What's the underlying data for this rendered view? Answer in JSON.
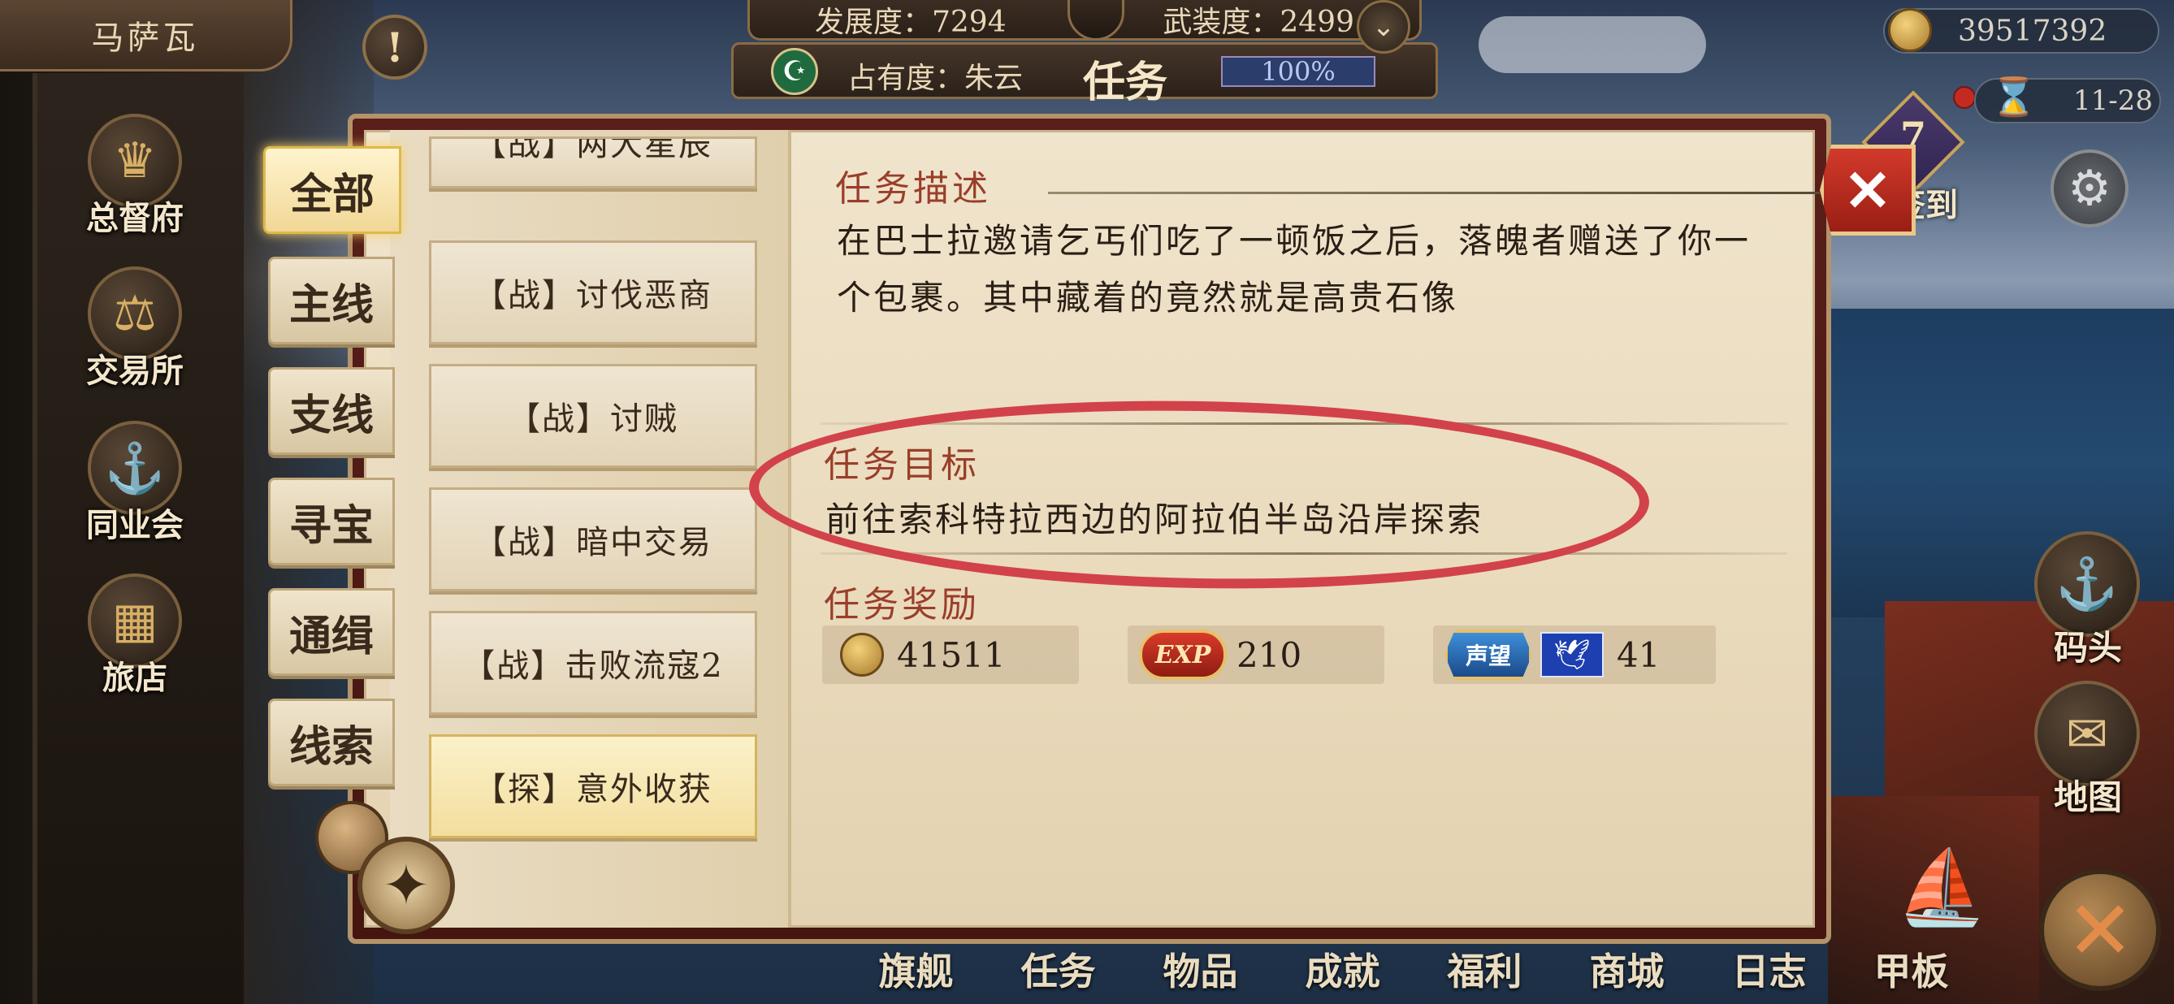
{
  "top_left": {
    "city_name": "马萨瓦",
    "alert_symbol": "!"
  },
  "stats": {
    "development": "发展度：7294",
    "armament": "武装度：2499",
    "occupancy_label": "占有度：朱云",
    "occupancy_value": "100%",
    "crescent_icon": "crescent-star-icon",
    "title": "任务"
  },
  "currency": {
    "gold": "39517392",
    "time": "11-28"
  },
  "signin": {
    "number": "7",
    "label": "签到"
  },
  "side_menu": [
    {
      "label": "总督府",
      "icon": "crown-icon",
      "glyph": "♛"
    },
    {
      "label": "交易所",
      "icon": "scales-icon",
      "glyph": "⚖"
    },
    {
      "label": "同业会",
      "icon": "anchor-shield-icon",
      "glyph": "⚓"
    },
    {
      "label": "旅店",
      "icon": "inn-icon",
      "glyph": "▦"
    }
  ],
  "right_menu": [
    {
      "label": "码头",
      "icon": "dock-icon",
      "glyph": "⚓"
    },
    {
      "label": "地图",
      "icon": "scroll-map-icon",
      "glyph": "✉"
    }
  ],
  "bottom_nav": [
    "旗舰",
    "任务",
    "物品",
    "成就",
    "福利",
    "商城",
    "日志",
    "甲板"
  ],
  "categories": [
    "全部",
    "主线",
    "支线",
    "寻宝",
    "通缉",
    "线索"
  ],
  "tasks": [
    "【战】两大星辰",
    "【战】讨伐恶商",
    "【战】讨贼",
    "【战】暗中交易",
    "【战】击败流寇2",
    "【探】意外收获"
  ],
  "detail": {
    "desc_title": "任务描述",
    "desc_text": "在巴士拉邀请乞丐们吃了一顿饭之后，落魄者赠送了你一个包裹。其中藏着的竟然就是高贵石像",
    "goal_title": "任务目标",
    "goal_text": "前往索科特拉西边的阿拉伯半岛沿岸探索",
    "reward_title": "任务奖励",
    "rewards": {
      "gold": "41511",
      "exp_label": "EXP",
      "exp": "210",
      "fame_label": "声望",
      "fame": "41"
    }
  },
  "colors": {
    "accent_red": "#d2424a",
    "title_red": "#9a3e2a",
    "parchment": "#eadbbd"
  }
}
